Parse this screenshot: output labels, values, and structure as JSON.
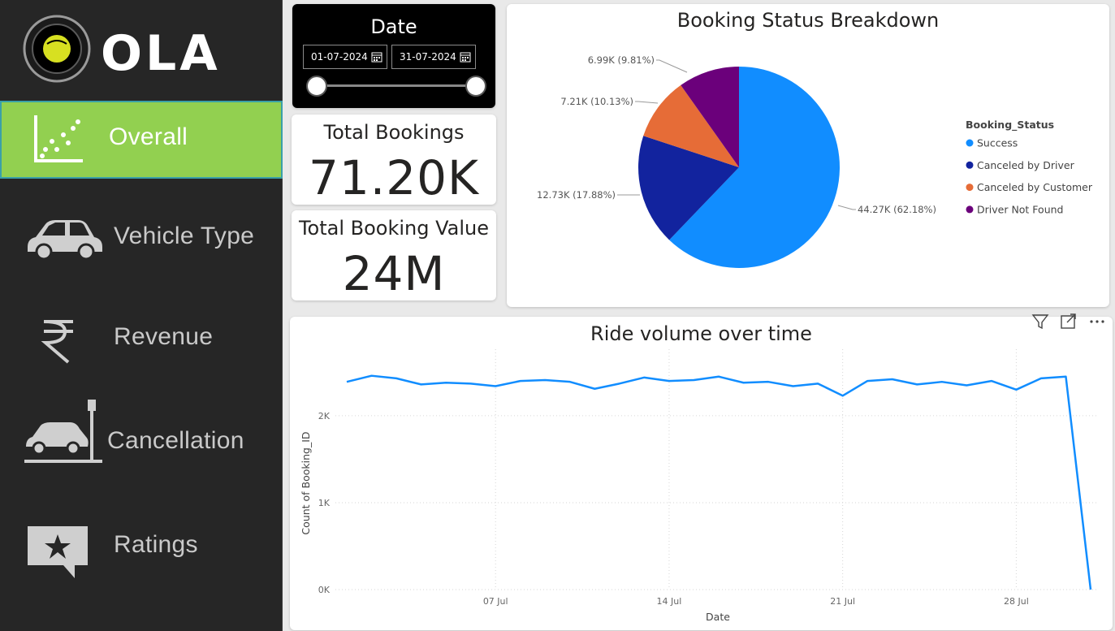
{
  "app": {
    "logo_text": "OLA"
  },
  "sidebar": {
    "items": [
      {
        "label": "Overall",
        "icon": "scatter-chart-icon",
        "active": true
      },
      {
        "label": "Vehicle Type",
        "icon": "car-icon",
        "active": false
      },
      {
        "label": "Revenue",
        "icon": "rupee-icon",
        "active": false
      },
      {
        "label": "Cancellation",
        "icon": "car-crash-icon",
        "active": false
      },
      {
        "label": "Ratings",
        "icon": "star-comment-icon",
        "active": false
      }
    ]
  },
  "date_filter": {
    "title": "Date",
    "start": "01-07-2024",
    "end": "31-07-2024"
  },
  "kpis": {
    "total_bookings_label": "Total Bookings",
    "total_bookings_value": "71.20K",
    "total_value_label": "Total Booking Value",
    "total_value_value": "24M"
  },
  "colors": {
    "sidebar_bg": "#262626",
    "active_nav": "#92d050",
    "success": "#118dff",
    "canceled_driver": "#12239e",
    "canceled_customer": "#e66c37",
    "driver_not_found": "#6b007b",
    "line": "#118dff"
  },
  "chart_data": [
    {
      "type": "pie",
      "title": "Booking Status Breakdown",
      "legend_title": "Booking_Status",
      "legend_position": "right",
      "slices": [
        {
          "label": "Success",
          "value": 44270,
          "data_label": "44.27K (62.18%)",
          "color": "#118dff"
        },
        {
          "label": "Canceled by Driver",
          "value": 12730,
          "data_label": "12.73K (17.88%)",
          "color": "#12239e"
        },
        {
          "label": "Canceled by Customer",
          "value": 7210,
          "data_label": "7.21K (10.13%)",
          "color": "#e66c37"
        },
        {
          "label": "Driver Not Found",
          "value": 6990,
          "data_label": "6.99K (9.81%)",
          "color": "#6b007b"
        }
      ]
    },
    {
      "type": "line",
      "title": "Ride volume over time",
      "xlabel": "Date",
      "ylabel": "Count of Booking_ID",
      "ylim": [
        0,
        2700
      ],
      "y_ticks": [
        0,
        1000,
        2000
      ],
      "y_tick_labels": [
        "0K",
        "1K",
        "2K"
      ],
      "x_tick_days": [
        7,
        14,
        21,
        28
      ],
      "x_tick_labels": [
        "07 Jul",
        "14 Jul",
        "21 Jul",
        "28 Jul"
      ],
      "grid": true,
      "x": [
        1,
        2,
        3,
        4,
        5,
        6,
        7,
        8,
        9,
        10,
        11,
        12,
        13,
        14,
        15,
        16,
        17,
        18,
        19,
        20,
        21,
        22,
        23,
        24,
        25,
        26,
        27,
        28,
        29,
        30,
        31
      ],
      "series": [
        {
          "values": [
            2390,
            2460,
            2430,
            2360,
            2380,
            2370,
            2340,
            2400,
            2410,
            2390,
            2310,
            2370,
            2440,
            2400,
            2410,
            2450,
            2380,
            2390,
            2340,
            2370,
            2230,
            2400,
            2420,
            2360,
            2390,
            2350,
            2400,
            2300,
            2430,
            2450,
            0
          ]
        }
      ]
    }
  ]
}
